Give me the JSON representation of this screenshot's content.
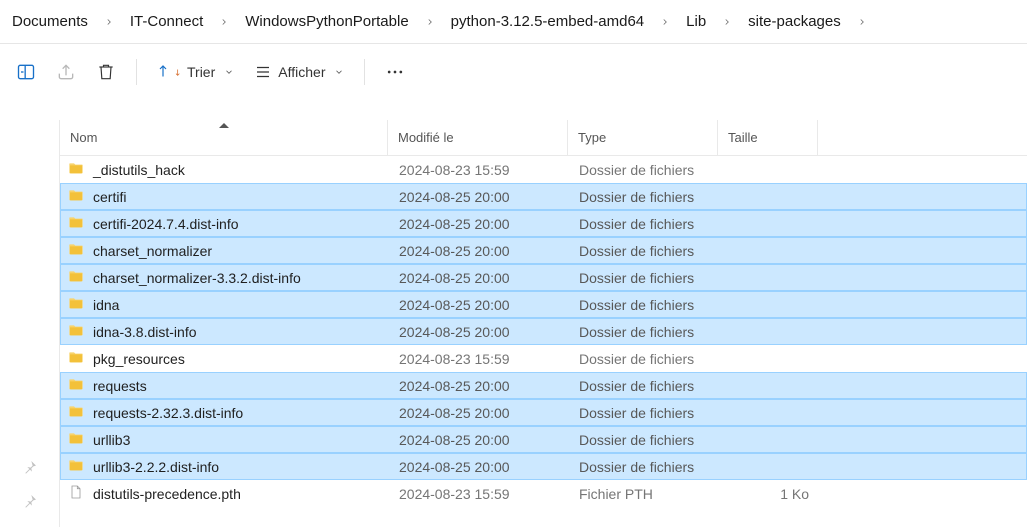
{
  "breadcrumb": [
    "Documents",
    "IT-Connect",
    "WindowsPythonPortable",
    "python-3.12.5-embed-amd64",
    "Lib",
    "site-packages"
  ],
  "toolbar": {
    "sort_label": "Trier",
    "view_label": "Afficher"
  },
  "columns": {
    "name": "Nom",
    "modified": "Modifié le",
    "type": "Type",
    "size": "Taille"
  },
  "rows": [
    {
      "name": "_distutils_hack",
      "modified": "2024-08-23 15:59",
      "type": "Dossier de fichiers",
      "size": "",
      "icon": "folder",
      "selected": false
    },
    {
      "name": "certifi",
      "modified": "2024-08-25 20:00",
      "type": "Dossier de fichiers",
      "size": "",
      "icon": "folder",
      "selected": true
    },
    {
      "name": "certifi-2024.7.4.dist-info",
      "modified": "2024-08-25 20:00",
      "type": "Dossier de fichiers",
      "size": "",
      "icon": "folder",
      "selected": true
    },
    {
      "name": "charset_normalizer",
      "modified": "2024-08-25 20:00",
      "type": "Dossier de fichiers",
      "size": "",
      "icon": "folder",
      "selected": true
    },
    {
      "name": "charset_normalizer-3.3.2.dist-info",
      "modified": "2024-08-25 20:00",
      "type": "Dossier de fichiers",
      "size": "",
      "icon": "folder",
      "selected": true
    },
    {
      "name": "idna",
      "modified": "2024-08-25 20:00",
      "type": "Dossier de fichiers",
      "size": "",
      "icon": "folder",
      "selected": true
    },
    {
      "name": "idna-3.8.dist-info",
      "modified": "2024-08-25 20:00",
      "type": "Dossier de fichiers",
      "size": "",
      "icon": "folder",
      "selected": true
    },
    {
      "name": "pkg_resources",
      "modified": "2024-08-23 15:59",
      "type": "Dossier de fichiers",
      "size": "",
      "icon": "folder",
      "selected": false
    },
    {
      "name": "requests",
      "modified": "2024-08-25 20:00",
      "type": "Dossier de fichiers",
      "size": "",
      "icon": "folder",
      "selected": true
    },
    {
      "name": "requests-2.32.3.dist-info",
      "modified": "2024-08-25 20:00",
      "type": "Dossier de fichiers",
      "size": "",
      "icon": "folder",
      "selected": true
    },
    {
      "name": "urllib3",
      "modified": "2024-08-25 20:00",
      "type": "Dossier de fichiers",
      "size": "",
      "icon": "folder",
      "selected": true
    },
    {
      "name": "urllib3-2.2.2.dist-info",
      "modified": "2024-08-25 20:00",
      "type": "Dossier de fichiers",
      "size": "",
      "icon": "folder",
      "selected": true
    },
    {
      "name": "distutils-precedence.pth",
      "modified": "2024-08-23 15:59",
      "type": "Fichier PTH",
      "size": "1 Ko",
      "icon": "file",
      "selected": false
    }
  ]
}
